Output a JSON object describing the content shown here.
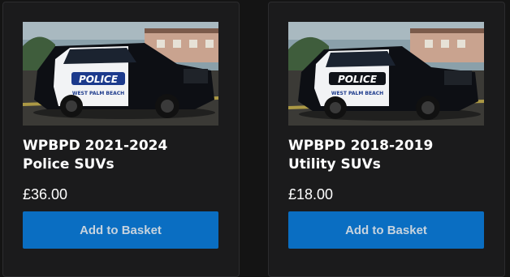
{
  "products": [
    {
      "image_icon": "police-suv-photo",
      "image_decal": "POLICE",
      "image_sub_decal": "WEST PALM BEACH",
      "title_line1": "WPBPD 2021-2024",
      "title_line2": "Police SUVs",
      "price": "£36.00",
      "button_label": "Add to Basket"
    },
    {
      "image_icon": "utility-suv-photo",
      "image_decal": "POLICE",
      "image_sub_decal": "WEST PALM BEACH",
      "title_line1": "WPBPD 2018-2019",
      "title_line2": "Utility SUVs",
      "price": "£18.00",
      "button_label": "Add to Basket"
    }
  ],
  "colors": {
    "background": "#141414",
    "card": "#1b1b1c",
    "button": "#0a6ec2",
    "button_text": "#c7d3de",
    "title_text": "#ffffff"
  }
}
